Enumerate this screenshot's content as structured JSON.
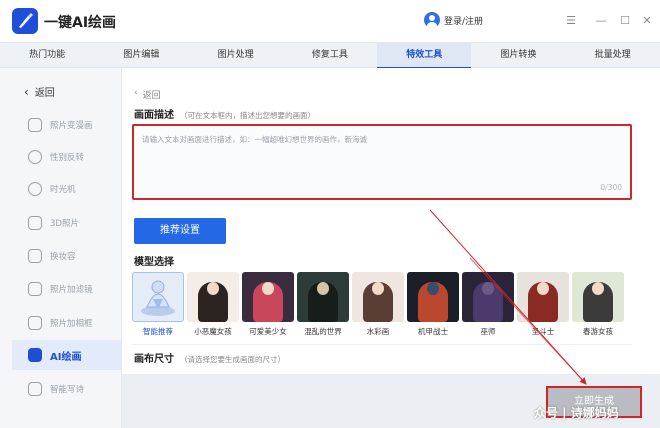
{
  "app": {
    "title": "一键AI绘画",
    "login_label": "登录/注册"
  },
  "window_controls": {
    "menu": "☰",
    "minimize": "—",
    "maximize": "☐",
    "close": "✕"
  },
  "tabs": [
    {
      "label": "热门功能"
    },
    {
      "label": "图片编辑"
    },
    {
      "label": "图片处理"
    },
    {
      "label": "修复工具"
    },
    {
      "label": "特效工具"
    },
    {
      "label": "图片转换"
    },
    {
      "label": "批量处理"
    }
  ],
  "active_tab": "特效工具",
  "sidebar": {
    "back_label": "返回",
    "items": [
      {
        "label": "照片变漫画",
        "icon": "photo-to-comic-icon"
      },
      {
        "label": "性别反转",
        "icon": "gender-swap-icon"
      },
      {
        "label": "时光机",
        "icon": "time-machine-icon"
      },
      {
        "label": "3D照片",
        "icon": "3d-photo-icon"
      },
      {
        "label": "换妆容",
        "icon": "makeup-icon"
      },
      {
        "label": "照片加滤镜",
        "icon": "filter-icon"
      },
      {
        "label": "照片加相框",
        "icon": "frame-icon"
      },
      {
        "label": "AI绘画",
        "icon": "ai-paint-icon"
      },
      {
        "label": "智能写诗",
        "icon": "poem-icon"
      }
    ],
    "active": "AI绘画"
  },
  "main": {
    "back_label": "返回",
    "description": {
      "title": "画面描述",
      "hint": "（可在文本框内，描述出您想要的画面）",
      "placeholder": "请输入文本对画面进行描述，如：一幅超唯幻想世界的画作，新海诚",
      "counter": "0/300"
    },
    "recommend_button": "推荐设置",
    "models": {
      "title": "模型选择",
      "items": [
        {
          "name": "智能推荐",
          "selected": true
        },
        {
          "name": "小恶魔女孩"
        },
        {
          "name": "可爱美少女"
        },
        {
          "name": "混乱的世界"
        },
        {
          "name": "水彩画"
        },
        {
          "name": "机甲战士"
        },
        {
          "name": "巫师"
        },
        {
          "name": "圣斗士"
        },
        {
          "name": "春游女孩"
        }
      ]
    },
    "canvas": {
      "title": "画布尺寸",
      "hint": "（请选择您要生成画面的尺寸）"
    },
    "generate_button": "立即生成"
  },
  "watermark": "众号 | 诗娜妈妈",
  "colors": {
    "accent": "#1c4fd3",
    "button": "#2468e6",
    "highlight_box": "#d0262b"
  }
}
